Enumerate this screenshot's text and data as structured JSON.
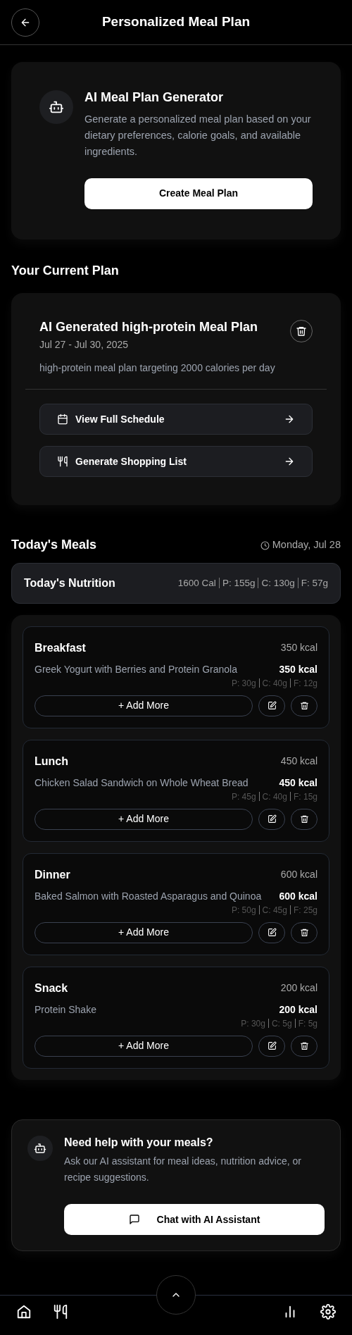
{
  "header": {
    "title": "Personalized Meal Plan"
  },
  "generator": {
    "title": "AI Meal Plan Generator",
    "description": "Generate a personalized meal plan based on your dietary preferences, calorie goals, and available ingredients.",
    "button": "Create Meal Plan"
  },
  "current_plan": {
    "heading": "Your Current Plan",
    "title": "AI Generated high-protein Meal Plan",
    "dates": "Jul 27 - Jul 30, 2025",
    "description": "high-protein meal plan targeting 2000 calories per day",
    "actions": [
      {
        "kind": "calendar",
        "label": "View Full Schedule"
      },
      {
        "kind": "utensils",
        "label": "Generate Shopping List"
      }
    ]
  },
  "today": {
    "heading": "Today's Meals",
    "date": "Monday, Jul 28",
    "nutrition": {
      "title": "Today's Nutrition",
      "values": [
        "1600 Cal",
        "P: 155g",
        "C: 130g",
        "F: 57g"
      ]
    },
    "meals": [
      {
        "name": "Breakfast",
        "kcal": "350 kcal",
        "item": "Greek Yogurt with Berries and Protein Granola",
        "item_kcal": "350 kcal",
        "macros": [
          "P: 30g",
          "C: 40g",
          "F: 12g"
        ],
        "add": "+ Add More"
      },
      {
        "name": "Lunch",
        "kcal": "450 kcal",
        "item": "Chicken Salad Sandwich on Whole Wheat Bread",
        "item_kcal": "450 kcal",
        "macros": [
          "P: 45g",
          "C: 40g",
          "F: 15g"
        ],
        "add": "+ Add More"
      },
      {
        "name": "Dinner",
        "kcal": "600 kcal",
        "item": "Baked Salmon with Roasted Asparagus and Quinoa",
        "item_kcal": "600 kcal",
        "macros": [
          "P: 50g",
          "C: 45g",
          "F: 25g"
        ],
        "add": "+ Add More"
      },
      {
        "name": "Snack",
        "kcal": "200 kcal",
        "item": "Protein Shake",
        "item_kcal": "200 kcal",
        "macros": [
          "P: 30g",
          "C: 5g",
          "F: 5g"
        ],
        "add": "+ Add More"
      }
    ]
  },
  "assistant": {
    "title": "Need help with your meals?",
    "description": "Ask our AI assistant for meal ideas, nutrition advice, or recipe suggestions.",
    "button": "Chat with AI Assistant"
  },
  "bottom_nav": [
    {
      "kind": "home"
    },
    {
      "kind": "utensils"
    },
    {
      "kind": "chart"
    },
    {
      "kind": "settings"
    }
  ]
}
